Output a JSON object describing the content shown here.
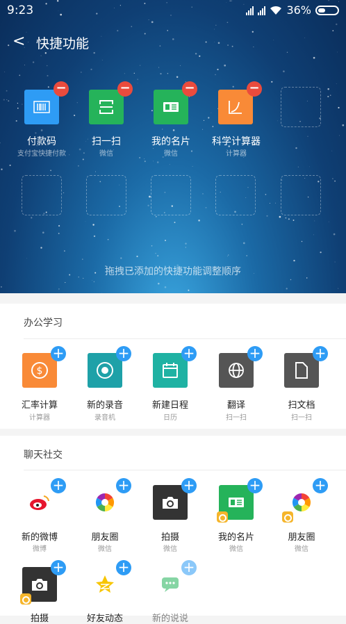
{
  "status": {
    "time": "9:23",
    "battery": "36%"
  },
  "nav": {
    "title": "快捷功能"
  },
  "added": [
    {
      "label": "付款码",
      "sub": "支付宝快捷付款",
      "color": "#2e9cf5",
      "icon": "barcode-icon"
    },
    {
      "label": "扫一扫",
      "sub": "微信",
      "color": "#25b35a",
      "icon": "scan-icon"
    },
    {
      "label": "我的名片",
      "sub": "微信",
      "color": "#25b35a",
      "icon": "card-icon"
    },
    {
      "label": "科学计算器",
      "sub": "计算器",
      "color": "#f98a37",
      "icon": "chart-icon"
    }
  ],
  "hint": "拖拽已添加的快捷功能调整顺序",
  "office": {
    "title": "办公学习",
    "items": [
      {
        "label": "汇率计算",
        "sub": "计算器",
        "color": "#f98a37",
        "icon": "dollar-icon"
      },
      {
        "label": "新的录音",
        "sub": "录音机",
        "color": "#1ea1a8",
        "icon": "record-icon"
      },
      {
        "label": "新建日程",
        "sub": "日历",
        "color": "#1fb2a3",
        "icon": "calendar-icon"
      },
      {
        "label": "翻译",
        "sub": "扫一扫",
        "color": "#555555",
        "icon": "globe-icon"
      },
      {
        "label": "扫文档",
        "sub": "扫一扫",
        "color": "#555555",
        "icon": "document-icon"
      }
    ]
  },
  "social": {
    "title": "聊天社交",
    "items": [
      {
        "label": "新的微博",
        "sub": "微博",
        "color": "#ffffff",
        "icon": "weibo-icon"
      },
      {
        "label": "朋友圈",
        "sub": "微信",
        "color": "#ffffff",
        "icon": "moments-icon"
      },
      {
        "label": "拍摄",
        "sub": "微信",
        "color": "#333333",
        "icon": "camera-icon"
      },
      {
        "label": "我的名片",
        "sub": "微信",
        "color": "#25b35a",
        "icon": "card-icon"
      },
      {
        "label": "朋友圈",
        "sub": "微信",
        "color": "#ffffff",
        "icon": "moments-icon"
      },
      {
        "label": "拍摄",
        "sub": "",
        "color": "#333333",
        "icon": "camera-icon"
      },
      {
        "label": "好友动态",
        "sub": "",
        "color": "#ffffff",
        "icon": "qzone-star-icon"
      },
      {
        "label": "新的说说",
        "sub": "",
        "color": "#ffffff",
        "icon": "chat-bubble-icon"
      }
    ]
  }
}
